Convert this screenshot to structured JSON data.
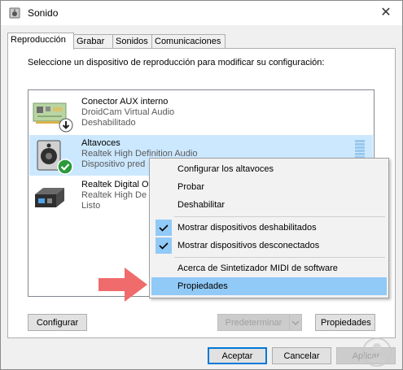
{
  "window": {
    "title": "Sonido",
    "close_glyph": "✕"
  },
  "tabs": [
    "Reproducción",
    "Grabar",
    "Sonidos",
    "Comunicaciones"
  ],
  "instruction": "Seleccione un dispositivo de reproducción para modificar su configuración:",
  "devices": [
    {
      "name": "Conector AUX interno",
      "description": "DroidCam Virtual Audio",
      "status": "Deshabilitado",
      "icon": "circuit-board-icon",
      "badge": "disabled-down-arrow-icon",
      "selected": false
    },
    {
      "name": "Altavoces",
      "description": "Realtek High Definition Audio",
      "status": "Dispositivo pred",
      "icon": "speaker-icon",
      "badge": "default-check-icon",
      "selected": true
    },
    {
      "name": "Realtek Digital O",
      "description": "Realtek High De",
      "status": "Listo",
      "icon": "digital-output-icon",
      "badge": null,
      "selected": false
    }
  ],
  "context_menu": {
    "items": [
      {
        "label": "Configurar los altavoces",
        "checked": false,
        "highlighted": false
      },
      {
        "label": "Probar",
        "checked": false,
        "highlighted": false
      },
      {
        "label": "Deshabilitar",
        "checked": false,
        "highlighted": false
      },
      {
        "label": "Mostrar dispositivos deshabilitados",
        "checked": true,
        "highlighted": false
      },
      {
        "label": "Mostrar dispositivos desconectados",
        "checked": true,
        "highlighted": false
      },
      {
        "label": "Acerca de Sintetizador MIDI de software",
        "checked": false,
        "highlighted": false
      },
      {
        "label": "Propiedades",
        "checked": false,
        "highlighted": true
      }
    ]
  },
  "buttons": {
    "configure": "Configurar",
    "set_default": "Predeterminar",
    "properties": "Propiedades",
    "accept": "Aceptar",
    "cancel": "Cancelar",
    "apply": "Aplicar"
  },
  "colors": {
    "selection": "#cce8ff",
    "menu_highlight": "#91c9f7",
    "accent": "#0078d7",
    "arrow": "#f06b6b"
  }
}
